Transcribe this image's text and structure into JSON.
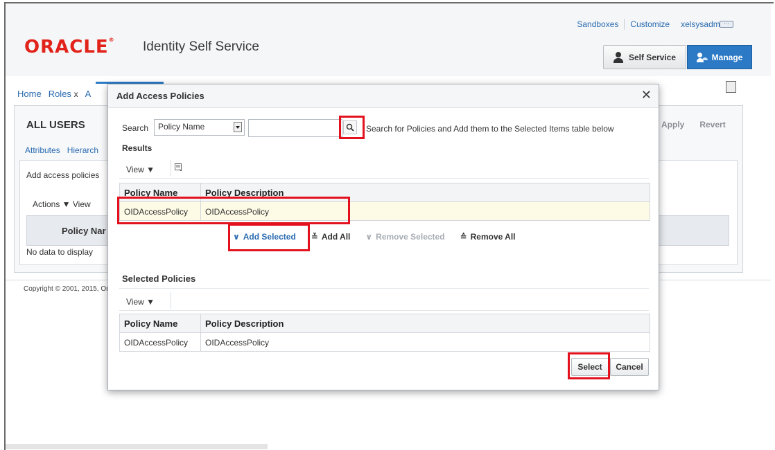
{
  "header": {
    "links": [
      "Sandboxes",
      "Customize",
      "xelsysadm ▼"
    ],
    "logo_text": "ORACLE",
    "logo_mark": "®",
    "app_title": "Identity Self Service",
    "self_service_label": "Self Service",
    "manage_label": "Manage",
    "accent": "#2c7ac6"
  },
  "background": {
    "tabs": [
      "Home",
      "Roles",
      "A"
    ],
    "tab_close": "x",
    "page_title": "ALL USERS",
    "subtabs": [
      "Attributes",
      "Hierarch"
    ],
    "note": "Add access policies",
    "actions_row": "Actions ▼   View",
    "column": "Policy Nar",
    "no_data": "No data to display",
    "apply_label": "Apply",
    "revert_label": "Revert",
    "copyright": "Copyright © 2001, 2015, Or"
  },
  "modal": {
    "title": "Add Access Policies",
    "close": "✕",
    "search_label": "Search",
    "search_field": "Policy Name",
    "search_value": "",
    "search_hint": "Search for Policies and Add them to the Selected Items table below",
    "results_label": "Results",
    "view_label": "View ▼",
    "columns": [
      "Policy Name",
      "Policy Description"
    ],
    "results_rows": [
      [
        "OIDAccessPolicy",
        "OIDAccessPolicy"
      ]
    ],
    "move": {
      "add_selected": "Add Selected",
      "add_all": "Add All",
      "remove_selected": "Remove Selected",
      "remove_all": "Remove All"
    },
    "selected_label": "Selected Policies",
    "selected_view_label": "View ▼",
    "selected_rows": [
      [
        "OIDAccessPolicy",
        "OIDAccessPolicy"
      ]
    ],
    "select_button": "Select",
    "cancel_button": "Cancel",
    "highlight_color": "#e3101d"
  }
}
